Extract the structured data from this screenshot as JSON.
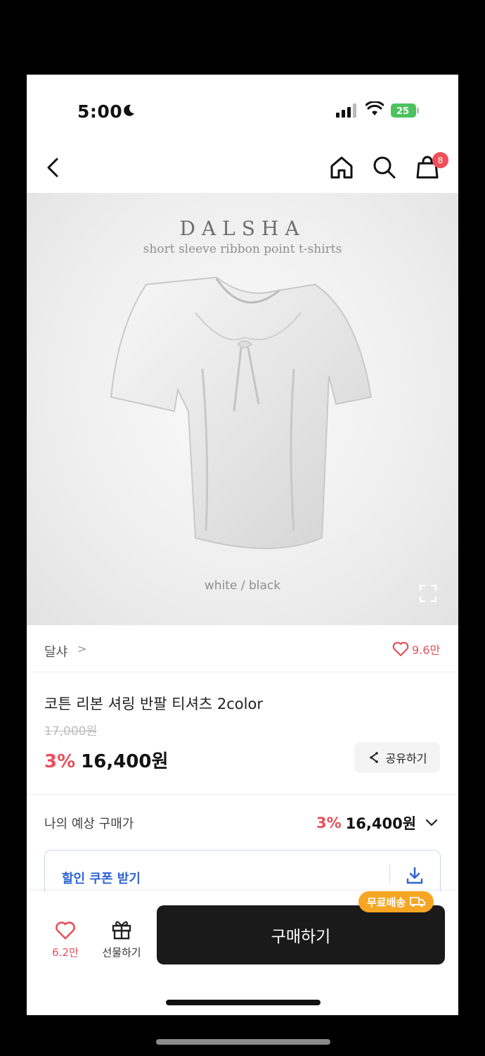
{
  "status_bar": {
    "time": "5:00",
    "battery": "25"
  },
  "nav": {
    "cart_count": "8"
  },
  "hero": {
    "logo": "DALSHA",
    "subtitle": "short sleeve ribbon point t-shirts",
    "colors_text": "white / black"
  },
  "brand": {
    "name": "달샤",
    "chevron": ">",
    "likes": "9.6만"
  },
  "product": {
    "title": "코튼 리본 셔링 반팔 티셔츠 2color",
    "original_price": "17,000원",
    "discount": "3%",
    "price": "16,400원"
  },
  "share": {
    "label": "공유하기"
  },
  "expected": {
    "label": "나의 예상 구매가",
    "discount": "3%",
    "price": "16,400원"
  },
  "coupon": {
    "label": "할인 쿠폰 받기"
  },
  "bottom_bar": {
    "like_count": "6.2만",
    "gift_label": "선물하기",
    "buy_label": "구매하기",
    "free_shipping": "무료배송"
  },
  "colors": {
    "accent_red": "#e8505b",
    "coupon_blue": "#2e64d1",
    "shipping_orange": "#f6a623",
    "buy_black": "#1a1a1a"
  }
}
